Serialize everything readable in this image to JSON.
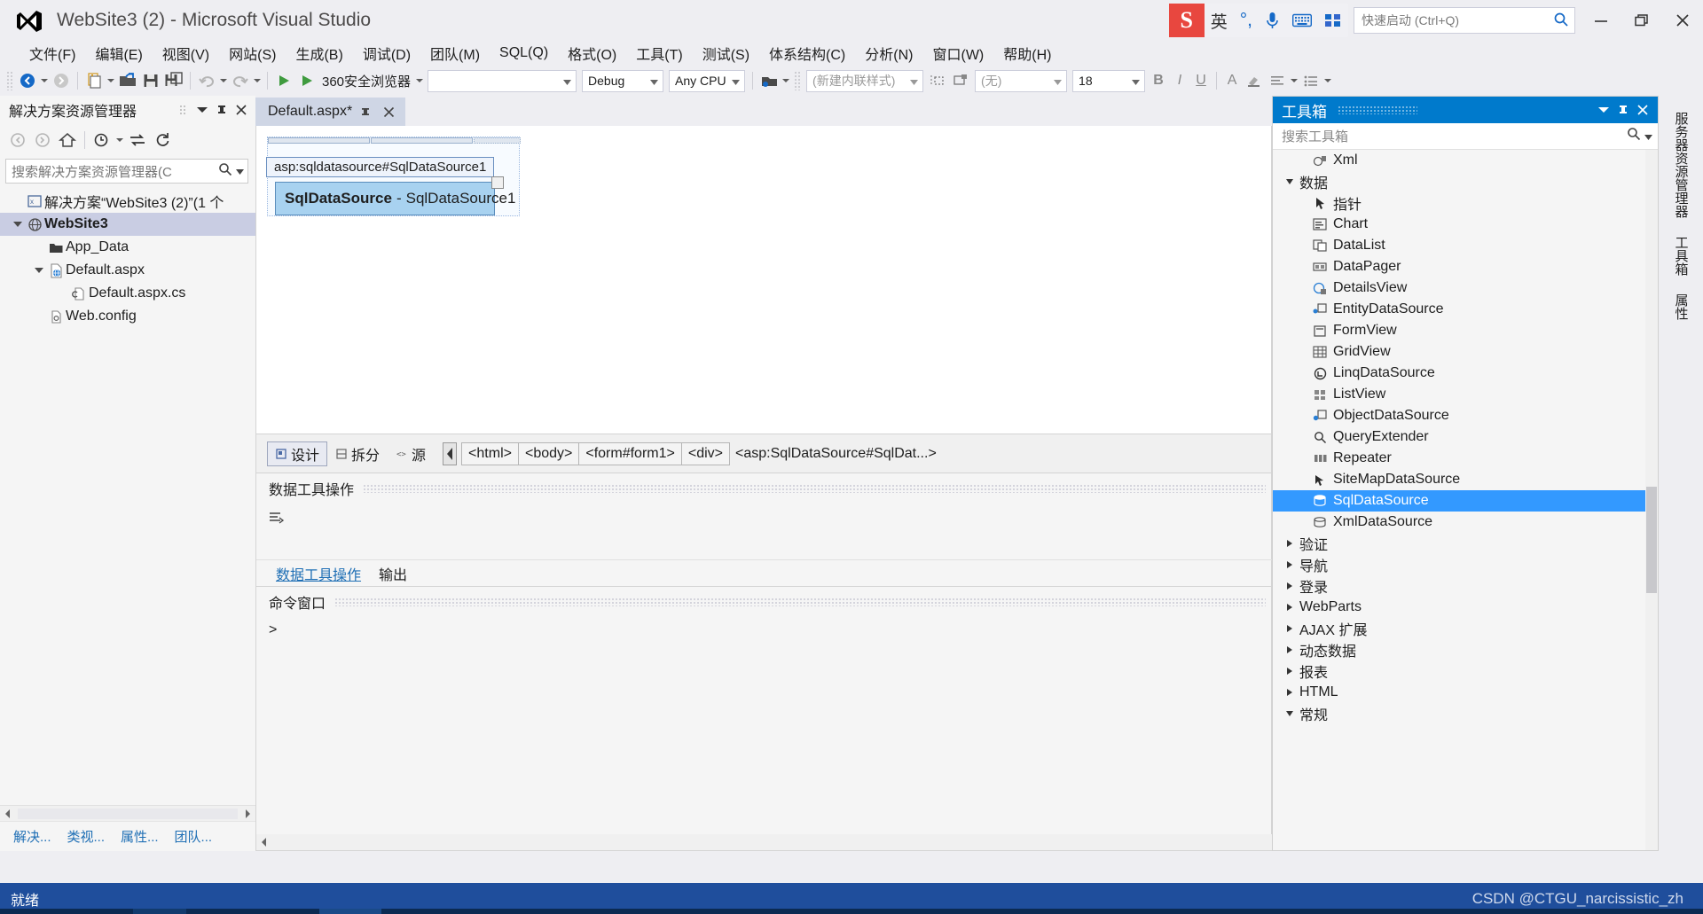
{
  "titlebar": {
    "app_title": "WebSite3 (2) - Microsoft Visual Studio",
    "logo_icon": "visual-studio-logo",
    "ime": {
      "mode_badge": "S",
      "lang_label": "英",
      "punctuation_icon": "°,",
      "mic_icon": "microphone-icon",
      "keyboard_icon": "keyboard-icon",
      "apps_icon": "grid-apps-icon"
    },
    "quick_launch": {
      "placeholder": "快速启动 (Ctrl+Q)",
      "icon": "search-icon"
    },
    "window_buttons": {
      "minimize": "—",
      "restore": "❐",
      "close": "✕"
    }
  },
  "menubar": {
    "items": [
      "文件(F)",
      "编辑(E)",
      "视图(V)",
      "网站(S)",
      "生成(B)",
      "调试(D)",
      "团队(M)",
      "SQL(Q)",
      "格式(O)",
      "工具(T)",
      "测试(S)",
      "体系结构(C)",
      "分析(N)",
      "窗口(W)",
      "帮助(H)"
    ]
  },
  "toolbar": {
    "nav_back_icon": "navigate-back-icon",
    "nav_forward_icon": "navigate-forward-icon",
    "new_item_icon": "new-item-icon",
    "open_icon": "open-file-icon",
    "save_icon": "save-icon",
    "save_all_icon": "save-all-icon",
    "undo_icon": "undo-icon",
    "redo_icon": "redo-icon",
    "start_icon": "start-debug-icon",
    "run_label": "360安全浏览器",
    "empty_combo_value": "",
    "config_value": "Debug",
    "platform_value": "Any CPU",
    "attach_icon": "attach-to-process-icon",
    "style_value": "(新建内联样式)",
    "style_target_icon": "style-target-icon",
    "style_apply_icon": "style-apply-icon",
    "font_family_value": "(无)",
    "font_size_value": "18",
    "bold_label": "B",
    "italic_label": "I",
    "underline_label": "U",
    "font_color_label": "A",
    "highlight_icon": "highlight-icon",
    "align_icon": "align-icon",
    "list_icon": "list-icon"
  },
  "solution_explorer": {
    "title": "解决方案资源管理器",
    "dropdown_icon": "chevron-down-icon",
    "pin_icon": "pin-icon",
    "close_icon": "close-icon",
    "toolbar_icons": [
      "back-icon",
      "forward-icon",
      "home-icon",
      "pending-changes-icon",
      "sync-with-active-doc-icon",
      "refresh-icon"
    ],
    "search": {
      "placeholder": "搜索解决方案资源管理器(C",
      "search_icon": "search-icon",
      "dropdown_icon": "chevron-down-icon"
    },
    "tree": [
      {
        "label": "解决方案“WebSite3 (2)”(1 个",
        "icon": "solution-icon",
        "indent": 0,
        "expander": "none",
        "selected": false,
        "bold": false
      },
      {
        "label": "WebSite3",
        "icon": "website-project-icon",
        "indent": 1,
        "expander": "open",
        "selected": true,
        "bold": true
      },
      {
        "label": "App_Data",
        "icon": "folder-icon",
        "indent": 2,
        "expander": "none",
        "selected": false,
        "bold": false
      },
      {
        "label": "Default.aspx",
        "icon": "aspx-file-icon",
        "indent": 2,
        "expander": "open",
        "selected": false,
        "bold": false
      },
      {
        "label": "Default.aspx.cs",
        "icon": "cs-file-icon",
        "indent": 3,
        "expander": "none",
        "selected": false,
        "bold": false
      },
      {
        "label": "Web.config",
        "icon": "config-file-icon",
        "indent": 2,
        "expander": "none",
        "selected": false,
        "bold": false
      }
    ],
    "bottom_tabs": [
      "解决...",
      "类视...",
      "属性...",
      "团队..."
    ]
  },
  "editor": {
    "tab": {
      "label": "Default.aspx*",
      "pin_icon": "pin-icon",
      "close_icon": "close-icon"
    },
    "designer": {
      "tag_label": "asp:sqldatasource#SqlDataSource1",
      "control_name": "SqlDataSource",
      "control_dash": "-",
      "control_id": "SqlDataSource1"
    },
    "view_tabs": [
      {
        "label": "设计",
        "icon": "design-view-icon",
        "active": true
      },
      {
        "label": "拆分",
        "icon": "split-view-icon",
        "active": false
      },
      {
        "label": "源",
        "icon": "source-view-icon",
        "active": false
      }
    ],
    "tag_navigator": {
      "scroll_icon": "scroll-left-icon",
      "chips": [
        "<html>",
        "<body>",
        "<form#form1>",
        "<div>"
      ],
      "last_chip": "<asp:SqlDataSource#SqlDat...>"
    }
  },
  "lower_panel": {
    "title": "数据工具操作",
    "toolbar_icon": "clear-all-icon",
    "tabs": [
      {
        "label": "数据工具操作",
        "active": true
      },
      {
        "label": "输出",
        "active": false
      }
    ]
  },
  "command_window": {
    "title": "命令窗口",
    "prompt": ">"
  },
  "toolbox": {
    "title": "工具箱",
    "dropdown_icon": "chevron-down-icon",
    "pin_icon": "pin-icon",
    "close_icon": "close-icon",
    "search": {
      "placeholder": "搜索工具箱",
      "search_icon": "search-icon",
      "dropdown_icon": "chevron-down-icon"
    },
    "rows": [
      {
        "kind": "item",
        "label": "Xml",
        "icon": "xml-control-icon",
        "selected": false
      },
      {
        "kind": "category",
        "label": "数据",
        "expanded": true
      },
      {
        "kind": "item",
        "label": "指针",
        "icon": "pointer-icon",
        "selected": false
      },
      {
        "kind": "item",
        "label": "Chart",
        "icon": "chart-control-icon",
        "selected": false
      },
      {
        "kind": "item",
        "label": "DataList",
        "icon": "datalist-control-icon",
        "selected": false
      },
      {
        "kind": "item",
        "label": "DataPager",
        "icon": "datapager-control-icon",
        "selected": false
      },
      {
        "kind": "item",
        "label": "DetailsView",
        "icon": "detailsview-control-icon",
        "selected": false
      },
      {
        "kind": "item",
        "label": "EntityDataSource",
        "icon": "entitydatasource-control-icon",
        "selected": false
      },
      {
        "kind": "item",
        "label": "FormView",
        "icon": "formview-control-icon",
        "selected": false
      },
      {
        "kind": "item",
        "label": "GridView",
        "icon": "gridview-control-icon",
        "selected": false
      },
      {
        "kind": "item",
        "label": "LinqDataSource",
        "icon": "linqdatasource-control-icon",
        "selected": false
      },
      {
        "kind": "item",
        "label": "ListView",
        "icon": "listview-control-icon",
        "selected": false
      },
      {
        "kind": "item",
        "label": "ObjectDataSource",
        "icon": "objectdatasource-control-icon",
        "selected": false
      },
      {
        "kind": "item",
        "label": "QueryExtender",
        "icon": "queryextender-control-icon",
        "selected": false
      },
      {
        "kind": "item",
        "label": "Repeater",
        "icon": "repeater-control-icon",
        "selected": false
      },
      {
        "kind": "item",
        "label": "SiteMapDataSource",
        "icon": "sitemapdatasource-control-icon",
        "selected": false
      },
      {
        "kind": "item",
        "label": "SqlDataSource",
        "icon": "sqldatasource-control-icon",
        "selected": true
      },
      {
        "kind": "item",
        "label": "XmlDataSource",
        "icon": "xmldatasource-control-icon",
        "selected": false
      },
      {
        "kind": "category",
        "label": "验证",
        "expanded": false
      },
      {
        "kind": "category",
        "label": "导航",
        "expanded": false
      },
      {
        "kind": "category",
        "label": "登录",
        "expanded": false
      },
      {
        "kind": "category",
        "label": "WebParts",
        "expanded": false
      },
      {
        "kind": "category",
        "label": "AJAX 扩展",
        "expanded": false
      },
      {
        "kind": "category",
        "label": "动态数据",
        "expanded": false
      },
      {
        "kind": "category",
        "label": "报表",
        "expanded": false
      },
      {
        "kind": "category",
        "label": "HTML",
        "expanded": false
      },
      {
        "kind": "category",
        "label": "常规",
        "expanded": true
      }
    ]
  },
  "right_edge_tabs": [
    "服务器资源管理器",
    "工具箱",
    "属性"
  ],
  "statusbar": {
    "text": "就绪",
    "watermark": "CSDN @CTGU_narcissistic_zh"
  },
  "colors": {
    "accent_blue": "#007acc",
    "status_blue": "#1f4e9c",
    "selection_blue": "#3399ff",
    "tree_selection": "#c9cde3",
    "chrome_gray": "#eeeef2"
  }
}
